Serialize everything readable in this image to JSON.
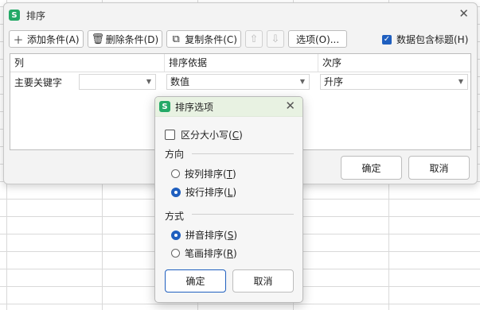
{
  "app_icon_letter": "S",
  "main_dialog": {
    "title": "排序",
    "toolbar": {
      "add_label": "添加条件(A)",
      "delete_label": "删除条件(D)",
      "copy_label": "复制条件(C)",
      "options_label": "选项(O)...",
      "header_checkbox_label": "数据包含标题(H)",
      "header_checked": true
    },
    "table": {
      "columns": [
        "列",
        "排序依据",
        "次序"
      ],
      "rows": [
        {
          "label": "主要关键字",
          "column_value": "",
          "sort_on": "数值",
          "order": "升序"
        }
      ]
    },
    "ok_label": "确定",
    "cancel_label": "取消"
  },
  "options_dialog": {
    "title": "排序选项",
    "case_label_main": "区分大小写(",
    "case_key": "C",
    "case_label_end": ")",
    "case_checked": false,
    "direction_title": "方向",
    "direction": [
      {
        "main": "按列排序(",
        "key": "T",
        "end": ")",
        "selected": false
      },
      {
        "main": "按行排序(",
        "key": "L",
        "end": ")",
        "selected": true
      }
    ],
    "method_title": "方式",
    "method": [
      {
        "main": "拼音排序(",
        "key": "S",
        "end": ")",
        "selected": true
      },
      {
        "main": "笔画排序(",
        "key": "R",
        "end": ")",
        "selected": false
      }
    ],
    "ok_label": "确定",
    "cancel_label": "取消"
  },
  "colors": {
    "accent": "#1f5fbf",
    "app_icon": "#24a967",
    "options_title_bg": "#e8f2e2"
  }
}
